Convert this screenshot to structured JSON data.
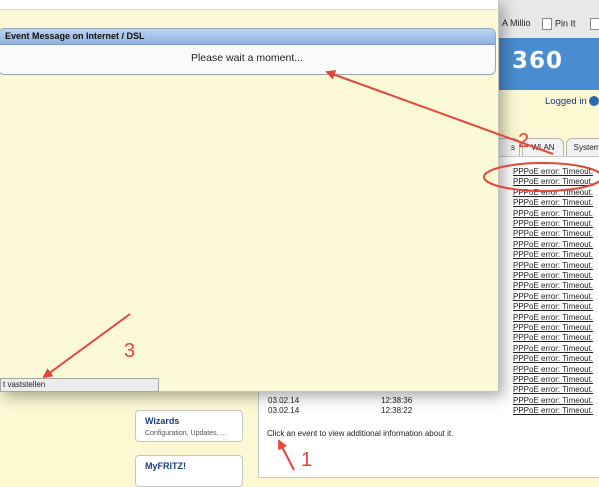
{
  "browser": {
    "bookmarks": [
      "A Millio",
      "Pin It"
    ]
  },
  "brand": {
    "text": "360"
  },
  "header": {
    "logged_in": "Logged in"
  },
  "tabs": [
    "s",
    "WLAN",
    "System"
  ],
  "event_log": {
    "rows": [
      {
        "date": "",
        "time": "",
        "message": "PPPoE error: Timeout."
      },
      {
        "date": "",
        "time": "",
        "message": "PPPoE error: Timeout."
      },
      {
        "date": "",
        "time": "",
        "message": "PPPoE error: Timeout."
      },
      {
        "date": "",
        "time": "",
        "message": "PPPoE error: Timeout."
      },
      {
        "date": "",
        "time": "",
        "message": "PPPoE error: Timeout."
      },
      {
        "date": "",
        "time": "",
        "message": "PPPoE error: Timeout."
      },
      {
        "date": "",
        "time": "",
        "message": "PPPoE error: Timeout."
      },
      {
        "date": "",
        "time": "",
        "message": "PPPoE error: Timeout."
      },
      {
        "date": "",
        "time": "",
        "message": "PPPoE error: Timeout."
      },
      {
        "date": "",
        "time": "",
        "message": "PPPoE error: Timeout."
      },
      {
        "date": "",
        "time": "",
        "message": "PPPoE error: Timeout."
      },
      {
        "date": "",
        "time": "",
        "message": "PPPoE error: Timeout."
      },
      {
        "date": "",
        "time": "",
        "message": "PPPoE error: Timeout."
      },
      {
        "date": "",
        "time": "",
        "message": "PPPoE error: Timeout."
      },
      {
        "date": "",
        "time": "",
        "message": "PPPoE error: Timeout."
      },
      {
        "date": "",
        "time": "",
        "message": "PPPoE error: Timeout."
      },
      {
        "date": "",
        "time": "",
        "message": "PPPoE error: Timeout."
      },
      {
        "date": "",
        "time": "",
        "message": "PPPoE error: Timeout."
      },
      {
        "date": "",
        "time": "",
        "message": "PPPoE error: Timeout."
      },
      {
        "date": "",
        "time": "",
        "message": "PPPoE error: Timeout."
      },
      {
        "date": "",
        "time": "",
        "message": "PPPoE error: Timeout."
      },
      {
        "date": "",
        "time": "",
        "message": "PPPoE error: Timeout."
      },
      {
        "date": "03.02.14",
        "time": "12:38:36",
        "message": "PPPoE error: Timeout."
      },
      {
        "date": "03.02.14",
        "time": "12:38:22",
        "message": "PPPoE error: Timeout."
      }
    ],
    "hint": "Click an event to view additional information about it."
  },
  "nav": {
    "wizards_title": "Wizards",
    "wizards_sub": "Configuration, Updates, ...",
    "myfritz_title": "MyFRITZ!"
  },
  "popup": {
    "title": "Event Message on Internet / DSL",
    "message": "Please wait a moment...",
    "status_text": "t vaststellen"
  },
  "annotations": [
    "1",
    "2",
    "3"
  ],
  "colors": {
    "annotation": "#e5463b",
    "popup_header": "#a9c7ea",
    "popup_bg": "#fbf9d6"
  }
}
